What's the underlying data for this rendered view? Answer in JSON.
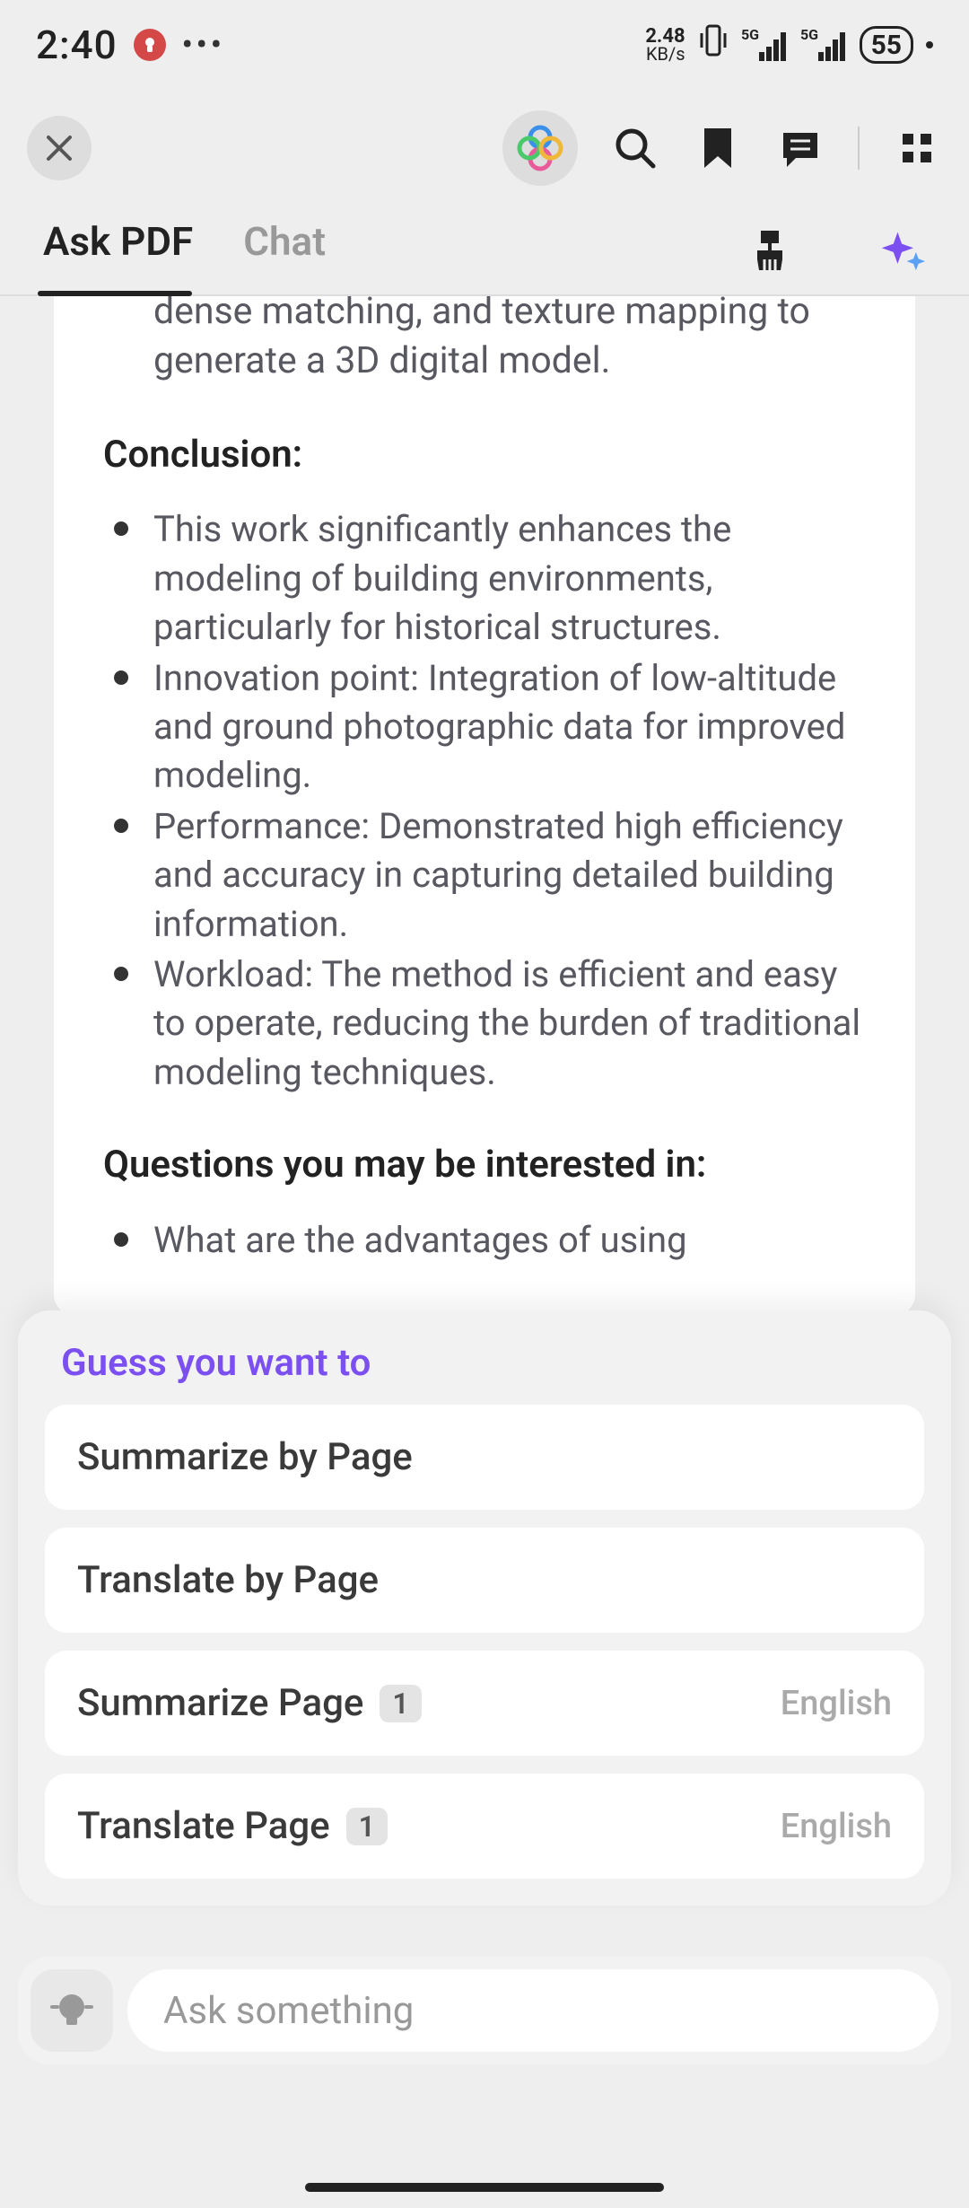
{
  "status": {
    "time": "2:40",
    "kbps_top": "2.48",
    "kbps_bot": "KB/s",
    "net_label": "5G",
    "battery": "55"
  },
  "tabs": {
    "askpdf": "Ask PDF",
    "chat": "Chat"
  },
  "content": {
    "cutoff": "dense matching, and texture mapping to generate a 3D digital model.",
    "conclusion_heading": "Conclusion:",
    "conclusion_items": [
      "This work significantly enhances the modeling of building environments, particularly for historical structures.",
      "Innovation point: Integration of low-altitude and ground photographic data for improved modeling.",
      "Performance: Demonstrated high efficiency and accuracy in capturing detailed building information.",
      "Workload: The method is efficient and easy to operate, reducing the burden of traditional modeling techniques."
    ],
    "questions_heading": "Questions you may be interested in:",
    "questions_items": [
      "What are the advantages of using"
    ]
  },
  "suggest": {
    "title": "Guess you want to",
    "items": [
      {
        "label": "Summarize by Page",
        "badge": "",
        "lang": ""
      },
      {
        "label": "Translate by Page",
        "badge": "",
        "lang": ""
      },
      {
        "label": "Summarize Page",
        "badge": "1",
        "lang": "English"
      },
      {
        "label": "Translate Page",
        "badge": "1",
        "lang": "English"
      }
    ]
  },
  "input": {
    "placeholder": "Ask something"
  }
}
